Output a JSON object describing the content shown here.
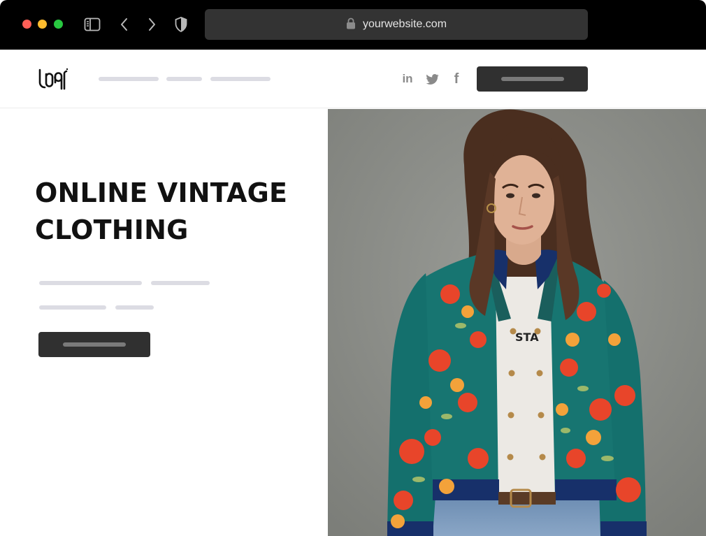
{
  "browser": {
    "url": "yourwebsite.com",
    "traffic_colors": [
      "#fe5f57",
      "#febc2e",
      "#28c840"
    ],
    "icons": [
      "sidebar-toggle-icon",
      "back-arrow-icon",
      "forward-arrow-icon",
      "shield-icon",
      "lock-icon"
    ]
  },
  "header": {
    "logo_icon": "brand-logo-icon",
    "social_icons": [
      "linkedin-icon",
      "twitter-icon",
      "facebook-icon"
    ],
    "linkedin_glyph": "in",
    "facebook_glyph": "f"
  },
  "hero": {
    "title_line1": "ONLINE VINTAGE",
    "title_line2": "CLOTHING",
    "photo_caption_visible": "STA"
  },
  "colors": {
    "chrome_bg": "#000000",
    "address_bar_bg": "#333333",
    "button_bg": "#303030",
    "placeholder_line": "#dcdce3",
    "title_text": "#111111"
  }
}
